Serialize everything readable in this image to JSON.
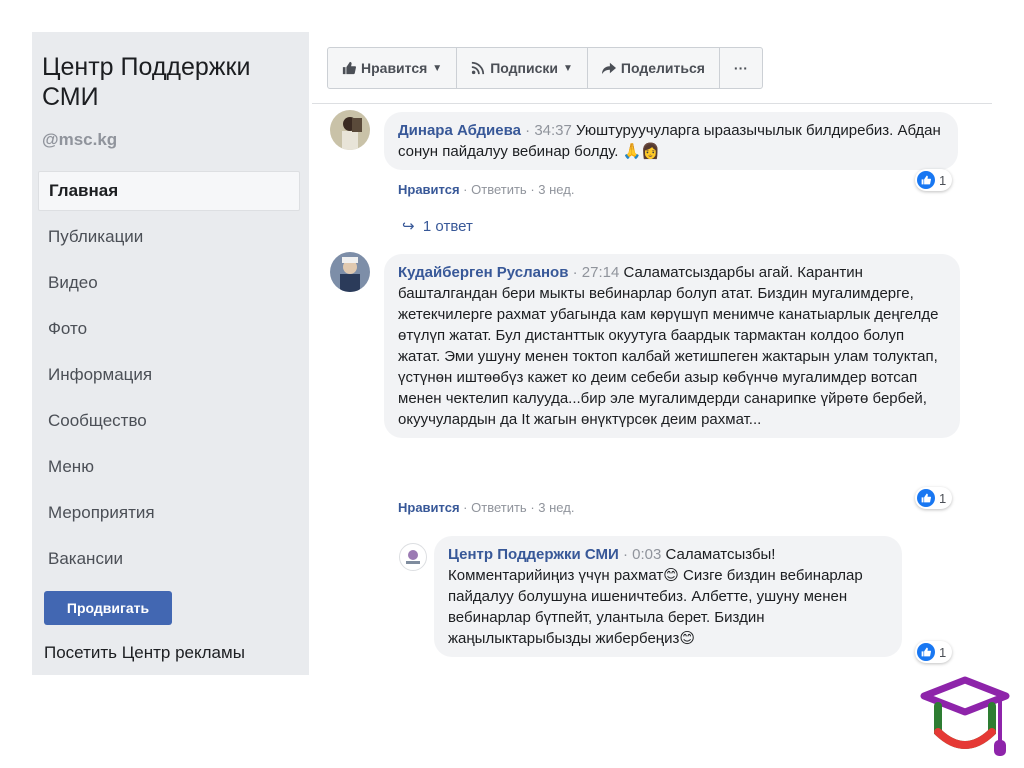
{
  "sidebar": {
    "page_name": "Центр Поддержки СМИ",
    "page_handle": "@msc.kg",
    "items": [
      {
        "label": "Главная"
      },
      {
        "label": "Публикации"
      },
      {
        "label": "Видео"
      },
      {
        "label": "Фото"
      },
      {
        "label": "Информация"
      },
      {
        "label": "Сообщество"
      },
      {
        "label": "Меню"
      },
      {
        "label": "Мероприятия"
      },
      {
        "label": "Вакансии"
      }
    ],
    "promote_label": "Продвигать",
    "ads_link": "Посетить Центр рекламы"
  },
  "action_bar": {
    "like_label": "Нравится",
    "follow_label": "Подписки",
    "share_label": "Поделиться",
    "more_label": "···"
  },
  "comments": [
    {
      "author": "Динара Абдиева",
      "time": "34:37",
      "text": "Уюштуруучуларга ыраазычылык билдиребиз. Абдан сонун пайдалуу вебинар болду.",
      "like_label": "Нравится",
      "reply_label": "Ответить",
      "age": "3 нед.",
      "reactions": "1",
      "replies_label": "1 ответ"
    },
    {
      "author": "Кудайберген Русланов",
      "time": "27:14",
      "text": "Саламатсыздарбы агай. Карантин башталгандан бери мыкты вебинарлар болуп атат. Биздин мугалимдерге, жетекчилерге рахмат убагында кам көрүшүп менимче канатыарлык деңгелде өтүлүп жатат. Бул дистанттык окуутуга баардык тармактан колдоо болуп жатат. Эми ушуну менен токтоп калбай жетишпеген жактарын улам толуктап, үстүнөн иштөөбүз кажет ко деим себеби азыр көбүнчө мугалимдер вотсап менен чектелип калууда...бир эле мугалимдерди санарипке үйрөтө бербей, окуучулардын да It жагын өнүктүрсөк деим рахмат...",
      "like_label": "Нравится",
      "reply_label": "Ответить",
      "age": "3 нед.",
      "reactions": "1"
    },
    {
      "author": "Центр Поддержки СМИ",
      "time": "0:03",
      "text": "Саламатсызбы! Комментарийиңиз үчүн рахмат😊 Сизге биздин вебинарлар пайдалуу болушуна ишеничтебиз. Албетте, ушуну менен вебинарлар бүтпейт, улантыла берет. Биздин жаңылыктарыбызды жибербеңиз😊",
      "reactions": "1"
    }
  ],
  "colors": {
    "brand_blue": "#4267b2",
    "link_blue": "#385898",
    "logo_purple": "#8e24aa",
    "logo_green": "#2e7d32"
  }
}
